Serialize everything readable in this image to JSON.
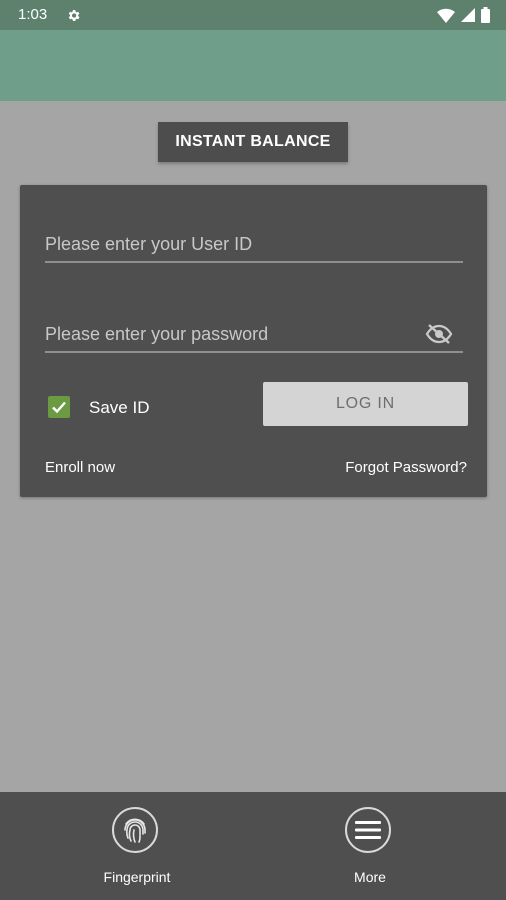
{
  "status_bar": {
    "time": "1:03",
    "settings_icon": "gear-icon",
    "wifi_icon": "wifi-icon",
    "signal_icon": "signal-icon",
    "battery_icon": "battery-icon"
  },
  "header": {
    "instant_balance_label": "INSTANT BALANCE"
  },
  "login_form": {
    "user_id_placeholder": "Please enter your User ID",
    "password_placeholder": "Please enter your password",
    "password_visibility_icon": "eye-off-icon",
    "save_id_label": "Save ID",
    "save_id_checked": true,
    "login_button_label": "LOG IN",
    "enroll_label": "Enroll now",
    "forgot_password_label": "Forgot Password?"
  },
  "bottom_nav": {
    "items": [
      {
        "label": "Fingerprint",
        "icon": "fingerprint-icon"
      },
      {
        "label": "More",
        "icon": "menu-icon"
      }
    ]
  },
  "colors": {
    "status_bar": "#5e816e",
    "header": "#6f9e8b",
    "background": "#a5a5a5",
    "card": "#4f4f4f",
    "checkbox": "#6c9a43",
    "login_button": "#d4d4d4"
  }
}
